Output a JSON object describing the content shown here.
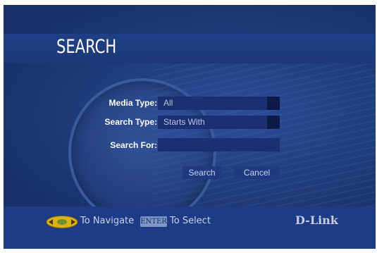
{
  "header": {
    "title": "SEARCH"
  },
  "form": {
    "media_type": {
      "label": "Media Type:",
      "value": "All"
    },
    "search_type": {
      "label": "Search Type:",
      "value": "Starts With"
    },
    "search_for": {
      "label": "Search For:",
      "value": ""
    }
  },
  "buttons": {
    "search": "Search",
    "cancel": "Cancel"
  },
  "footer": {
    "navigate_hint": "To Navigate",
    "enter_key": "ENTER",
    "select_hint": "To Select",
    "logo": "D-Link"
  },
  "icons": {
    "nav_pad": "dpad-icon"
  },
  "colors": {
    "background": "#21407f",
    "band": "#1e3b85",
    "field": "#1b2f71",
    "accent_yellow": "#e0c020"
  }
}
